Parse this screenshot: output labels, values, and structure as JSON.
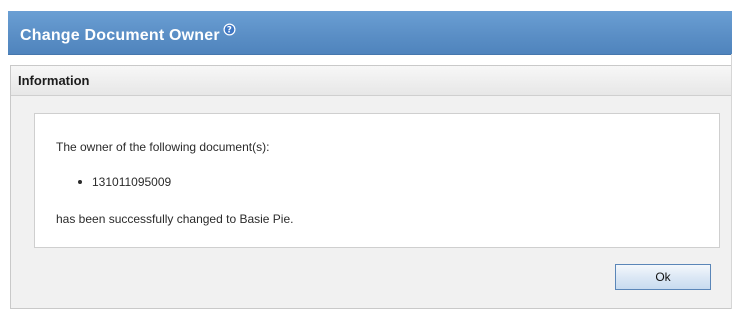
{
  "dialog": {
    "title": "Change Document Owner",
    "help_icon": "help-question-icon",
    "colors": {
      "titlebar": "#5b8fc6",
      "title_text": "#ffffff",
      "panel_bg": "#f1f1f1"
    }
  },
  "panel": {
    "header": "Information",
    "message_intro": "The owner of the following document(s):",
    "documents": [
      "131011095009"
    ],
    "message_result": "has been successfully changed to Basie Pie."
  },
  "actions": {
    "ok_label": "Ok"
  }
}
